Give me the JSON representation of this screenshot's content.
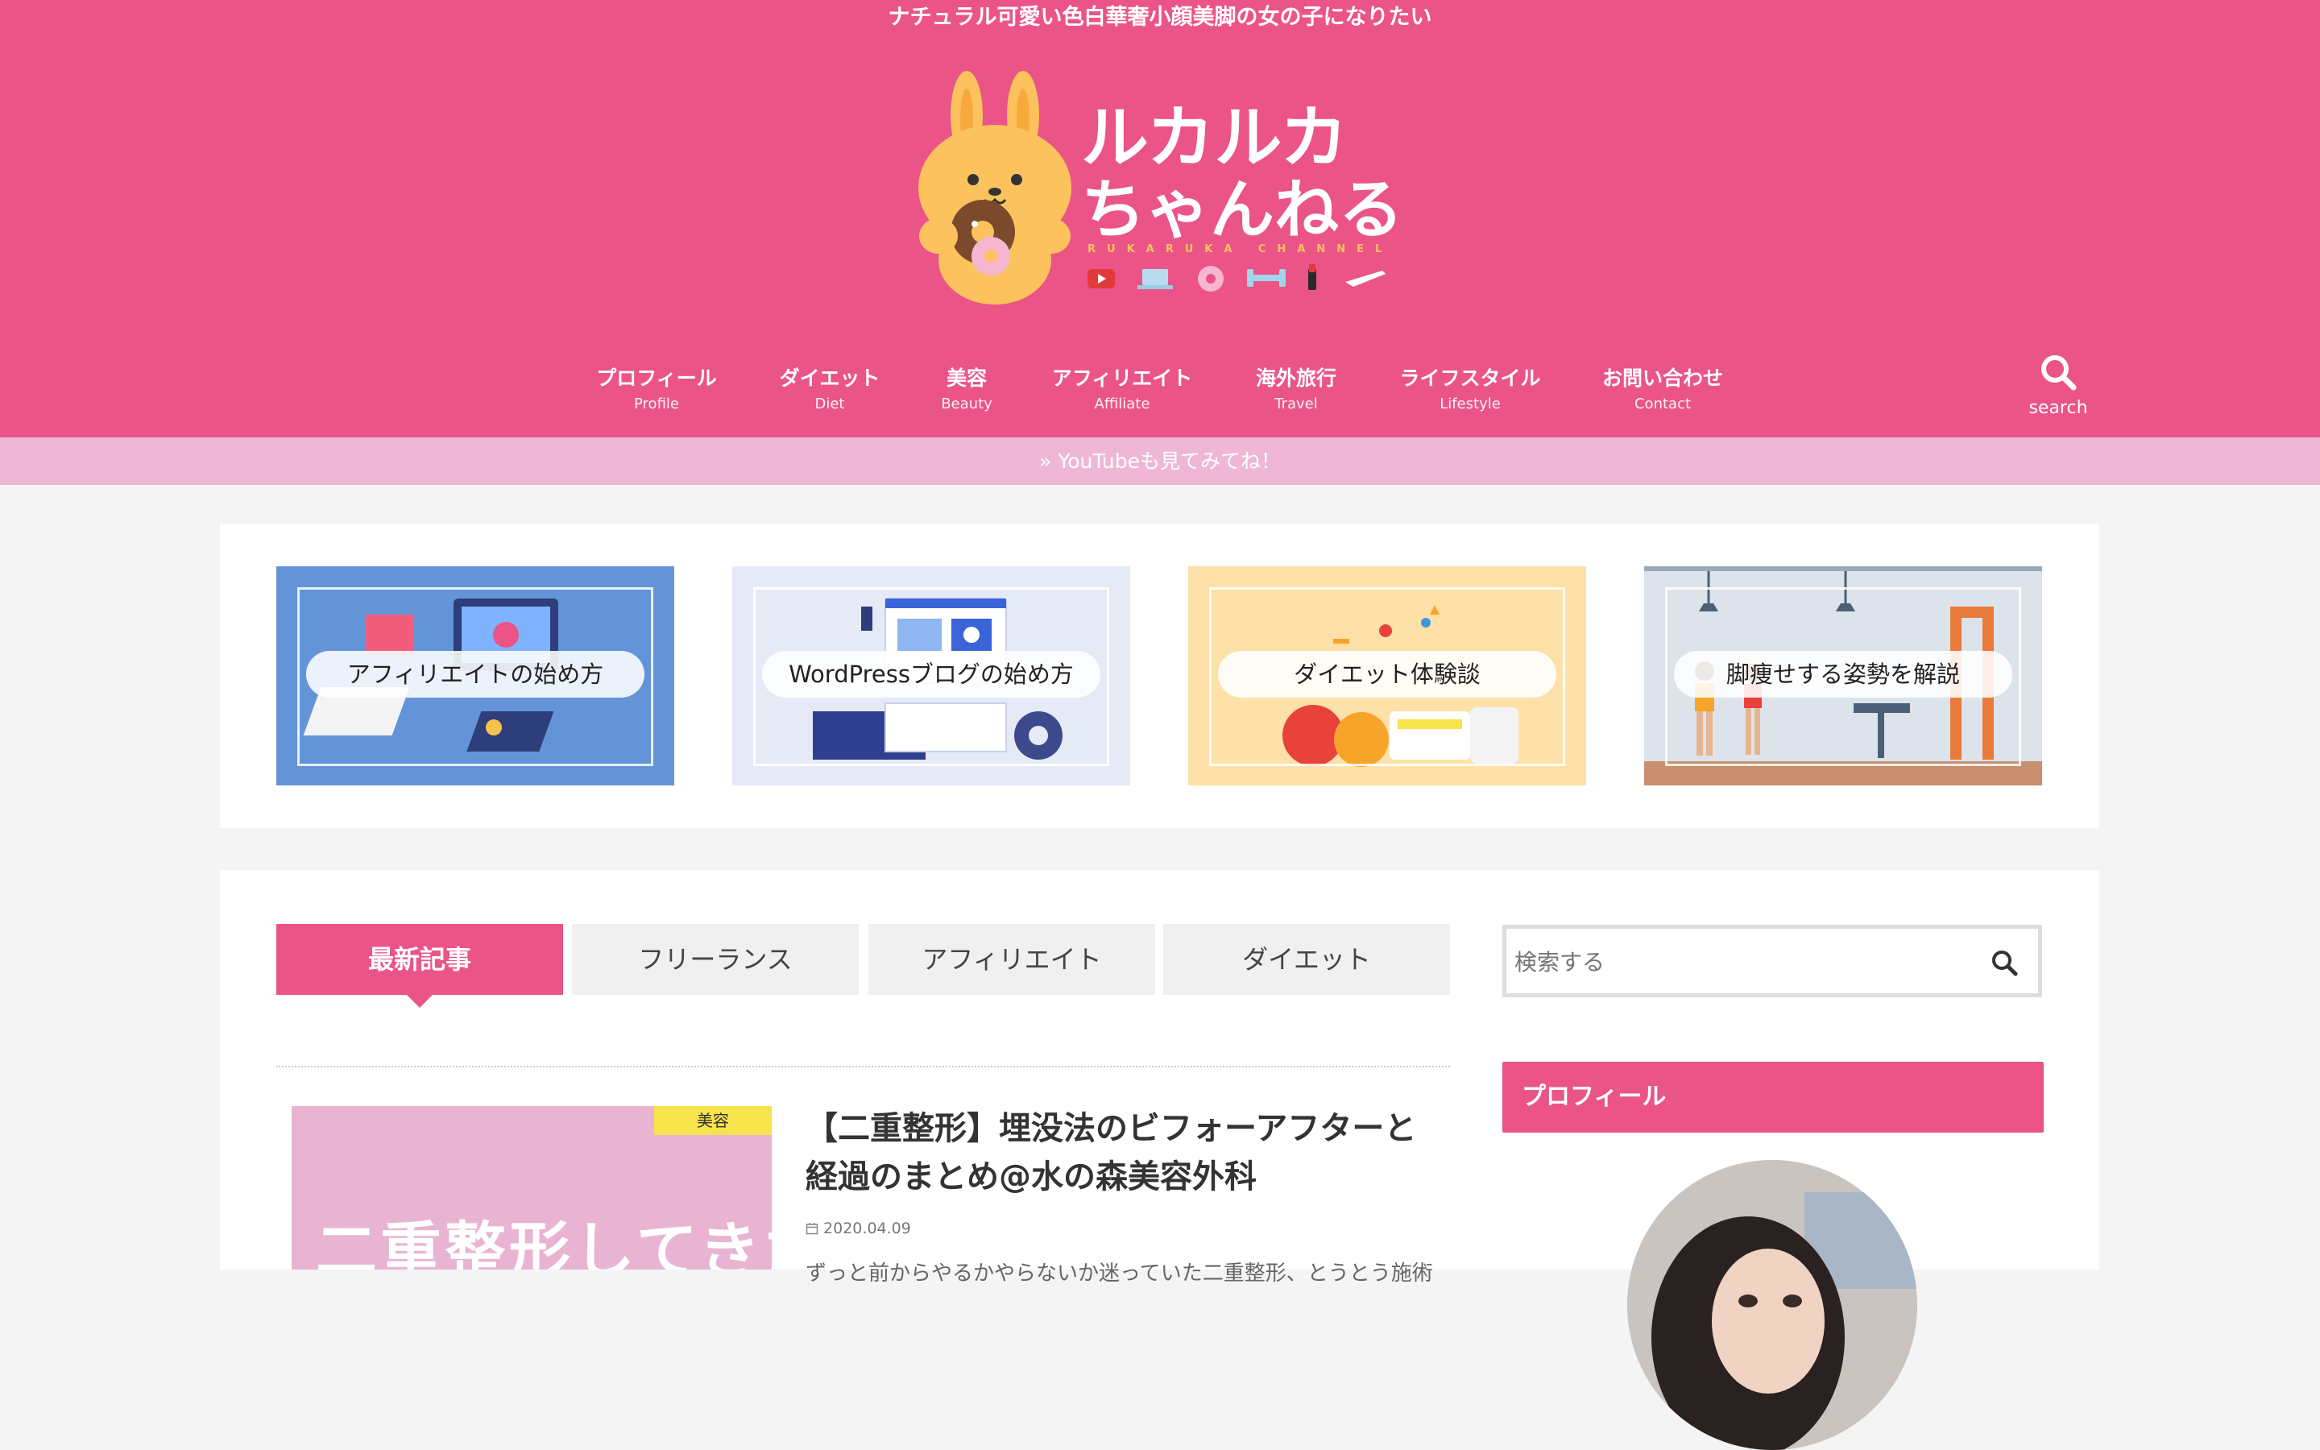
{
  "header": {
    "tagline": "ナチュラル可愛い色白華奢小顔美脚の女の子になりたい",
    "logo_line1": "ルカルカ",
    "logo_line2": "ちゃんねる",
    "logo_sub": "RUKARUKA CHANNEL",
    "bg_color": "#eb5487"
  },
  "nav": {
    "items": [
      {
        "label": "プロフィール",
        "sub": "Profile"
      },
      {
        "label": "ダイエット",
        "sub": "Diet"
      },
      {
        "label": "美容",
        "sub": "Beauty"
      },
      {
        "label": "アフィリエイト",
        "sub": "Affiliate"
      },
      {
        "label": "海外旅行",
        "sub": "Travel"
      },
      {
        "label": "ライフスタイル",
        "sub": "Lifestyle"
      },
      {
        "label": "お問い合わせ",
        "sub": "Contact"
      }
    ],
    "search_label": "search"
  },
  "notice": {
    "text": "» YouTubeも見てみてね！"
  },
  "features": {
    "cards": [
      {
        "label": "アフィリエイトの始め方",
        "bg": "#6494d8"
      },
      {
        "label": "WordPressブログの始め方",
        "bg": "#e6e9f6"
      },
      {
        "label": "ダイエット体験談",
        "bg": "#fde1a8"
      },
      {
        "label": "脚痩せする姿勢を解説",
        "bg": "#dde3ea"
      }
    ]
  },
  "tabs": [
    "最新記事",
    "フリーランス",
    "アフィリエイト",
    "ダイエット"
  ],
  "post": {
    "category": "美容",
    "thumb_text": "二重整形してきた話",
    "title": "【二重整形】埋没法のビフォーアフターと経過のまとめ@水の森美容外科",
    "date": "2020.04.09",
    "excerpt": "ずっと前からやるかやらないか迷っていた二重整形、とうとう施術"
  },
  "sidebar": {
    "search_placeholder": "検索する",
    "profile_heading": "プロフィール"
  }
}
